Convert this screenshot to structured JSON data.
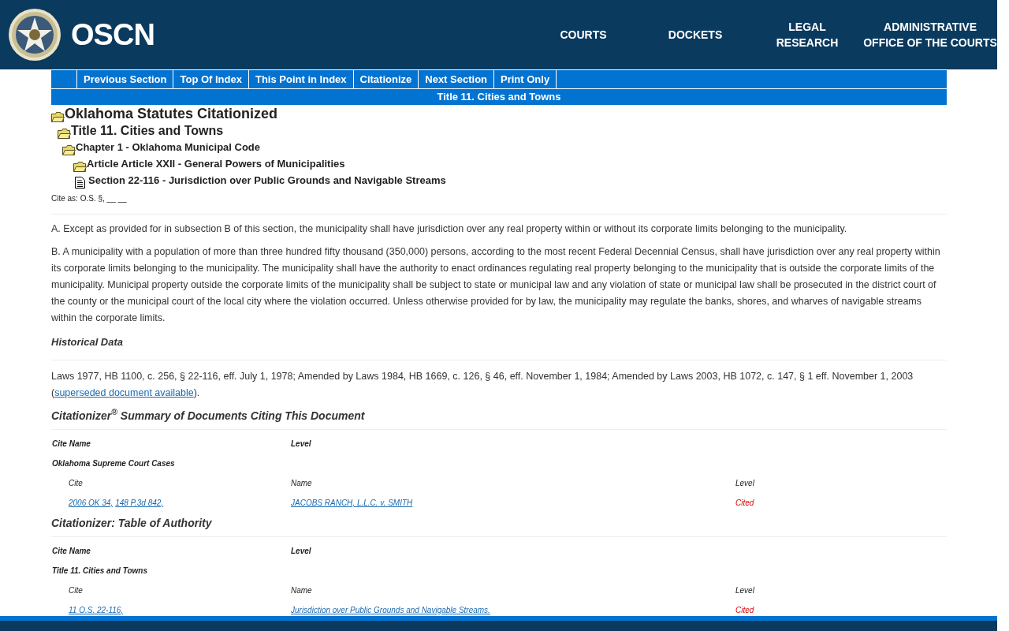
{
  "header": {
    "logo_text": "OSCN",
    "nav": [
      {
        "label": "COURTS"
      },
      {
        "label": "DOCKETS"
      },
      {
        "label": "LEGAL RESEARCH"
      },
      {
        "label": "ADMINISTRATIVE OFFICE OF THE COURTS"
      }
    ]
  },
  "toolbar": {
    "buttons": [
      "Previous Section",
      "Top Of Index",
      "This Point in Index",
      "Citationize",
      "Next Section",
      "Print Only"
    ],
    "title": "Title 11. Cities and Towns"
  },
  "breadcrumb": [
    {
      "kind": "folder",
      "label": "Oklahoma Statutes Citationized",
      "children": [
        {
          "kind": "folder",
          "label": "Title 11. Cities and Towns",
          "children": [
            {
              "kind": "folder",
              "label": "Chapter 1 - Oklahoma Municipal Code",
              "children": [
                {
                  "kind": "folder",
                  "label": "Article Article XXII - General Powers of Municipalities",
                  "children": [
                    {
                      "kind": "document",
                      "label": "Section 22-116 - Jurisdiction over Public Grounds and Navigable Streams"
                    }
                  ]
                }
              ]
            }
          ]
        }
      ]
    }
  ],
  "cite_as": "Cite as: O.S. §, __ __",
  "paragraphs": [
    "A. Except as provided for in subsection B of this section, the municipality shall have jurisdiction over any real property within or without its corporate limits belonging to the municipality.",
    "B. A municipality with a population of more than three hundred fifty thousand (350,000) persons, according to the most recent Federal Decennial Census, shall have jurisdiction over any real property within its corporate limits belonging to the municipality. The municipality shall have the authority to enact ordinances regulating real property belonging to the municipality that is outside the corporate limits of the municipality. Municipal property outside the corporate limits of the municipality shall be subject to state or municipal law and any violation of state or municipal law shall be prosecuted in the district court of the county or the municipal court of the local city where the violation occurred. Unless otherwise provided for by law, the municipality may regulate the banks, shores, and wharves of navigable streams within the corporate limits."
  ],
  "historical": {
    "heading": "Historical Data",
    "text": "Laws 1977, HB 1100, c. 256, § 22-116, eff. July 1, 1978; Amended by Laws 1984, HB 1669, c. 126, § 46, eff. November 1, 1984; Amended by Laws 2003, HB 1072, c. 147, § 1 eff. November 1, 2003 (",
    "link": "superseded document available",
    "after": ")."
  },
  "sections": [
    {
      "heading": "Citationizer$^{®}$ Summary of Documents Citing This Document",
      "head_cols": [
        "Cite Name",
        "Level"
      ],
      "group": "Oklahoma Supreme Court Cases",
      "sub_cols": [
        "Cite",
        "Name",
        "Level"
      ],
      "rows": [
        {
          "cites": [
            "2006 OK 34,",
            "148 P.3d 842,"
          ],
          "name": "JACOBS RANCH, L.L.C. v. SMITH",
          "level": "Cited"
        }
      ]
    },
    {
      "heading": "Citationizer: Table of Authority",
      "head_cols": [
        "Cite Name",
        "Level"
      ],
      "group": "Title 11. Cities and Towns",
      "sub_cols": [
        "Cite",
        "Name",
        "Level"
      ],
      "rows": [
        {
          "cites": [
            "11 O.S. 22-116,"
          ],
          "name": "Jurisdiction over Public Grounds and Navigable Streams.",
          "level": "Cited"
        }
      ]
    }
  ]
}
